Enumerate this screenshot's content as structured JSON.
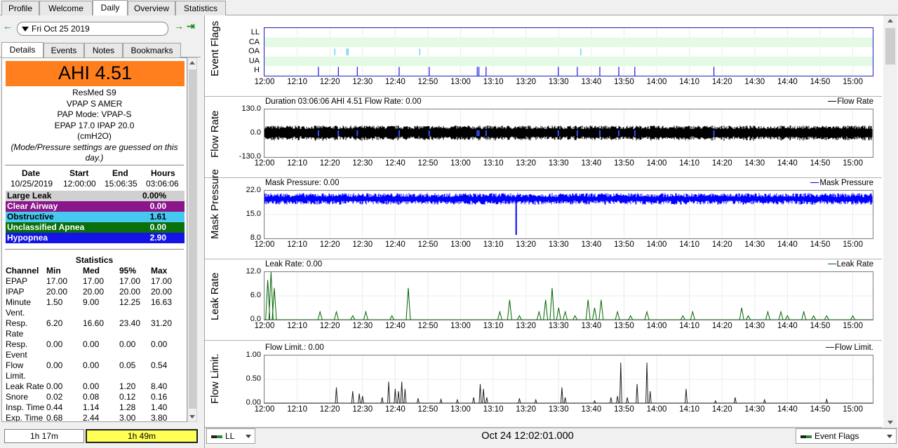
{
  "top_tabs": [
    "Profile",
    "Welcome",
    "Daily",
    "Overview",
    "Statistics"
  ],
  "active_top_tab": "Daily",
  "date_nav": {
    "date": "Fri Oct 25 2019",
    "prev_icon": "arrow-left-icon",
    "next_icon": "arrow-right-icon",
    "last_icon": "arrow-to-end-icon"
  },
  "sub_tabs": [
    "Details",
    "Events",
    "Notes",
    "Bookmarks"
  ],
  "active_sub_tab": "Details",
  "ahi": {
    "label": "AHI 4.51",
    "color": "#ff7f1e"
  },
  "machine": {
    "line1": "ResMed S9",
    "line2": "VPAP S AMER",
    "line3": "PAP Mode: VPAP-S",
    "line4": "EPAP 17.0 IPAP 20.0",
    "line5": "(cmH2O)",
    "note": "(Mode/Pressure settings are guessed on this day.)"
  },
  "session": {
    "headers": [
      "Date",
      "Start",
      "End",
      "Hours"
    ],
    "values": [
      "10/25/2019",
      "12:00:00",
      "15:06:35",
      "03:06:06"
    ]
  },
  "indices": [
    {
      "name": "Large Leak",
      "value": "0.00%",
      "bg": "#d0d0d0",
      "fg": "#000000"
    },
    {
      "name": "Clear Airway",
      "value": "0.00",
      "bg": "#8b168b",
      "fg": "#ffffff"
    },
    {
      "name": "Obstructive",
      "value": "1.61",
      "bg": "#46c8f0",
      "fg": "#000000"
    },
    {
      "name": "Unclassified Apnea",
      "value": "0.00",
      "bg": "#0a6e0a",
      "fg": "#ffffff"
    },
    {
      "name": "Hypopnea",
      "value": "2.90",
      "bg": "#1414e6",
      "fg": "#ffffff"
    }
  ],
  "statistics": {
    "title": "Statistics",
    "headers": [
      "Channel",
      "Min",
      "Med",
      "95%",
      "Max"
    ],
    "rows": [
      {
        "ch": [
          "EPAP"
        ],
        "v": [
          "17.00",
          "17.00",
          "17.00",
          "17.00"
        ]
      },
      {
        "ch": [
          "IPAP"
        ],
        "v": [
          "20.00",
          "20.00",
          "20.00",
          "20.00"
        ]
      },
      {
        "ch": [
          "Minute",
          "Vent."
        ],
        "v": [
          "1.50",
          "9.00",
          "12.25",
          "16.63"
        ]
      },
      {
        "ch": [
          "Resp.",
          "Rate"
        ],
        "v": [
          "6.20",
          "16.60",
          "23.40",
          "31.20"
        ]
      },
      {
        "ch": [
          "Resp.",
          "Event"
        ],
        "v": [
          "0.00",
          "0.00",
          "0.00",
          "0.00"
        ]
      },
      {
        "ch": [
          "Flow",
          "Limit."
        ],
        "v": [
          "0.00",
          "0.00",
          "0.05",
          "0.54"
        ]
      },
      {
        "ch": [
          "Leak Rate"
        ],
        "v": [
          "0.00",
          "0.00",
          "1.20",
          "8.40"
        ]
      },
      {
        "ch": [
          "Snore"
        ],
        "v": [
          "0.02",
          "0.08",
          "0.12",
          "0.16"
        ]
      },
      {
        "ch": [
          "Insp. Time"
        ],
        "v": [
          "0.44",
          "1.14",
          "1.28",
          "1.40"
        ]
      },
      {
        "ch": [
          "Exp. Time"
        ],
        "v": [
          "0.68",
          "2.44",
          "3.00",
          "3.80"
        ]
      }
    ]
  },
  "bottom_left": {
    "left_value": "1h 17m",
    "right_value": "1h 49m"
  },
  "x_ticks": [
    "12:00",
    "12:10",
    "12:20",
    "12:30",
    "12:40",
    "12:50",
    "13:00",
    "13:10",
    "13:20",
    "13:30",
    "13:40",
    "13:50",
    "14:00",
    "14:10",
    "14:20",
    "14:30",
    "14:40",
    "14:50",
    "15:00"
  ],
  "x_range_minutes": [
    0,
    186.1
  ],
  "graphs": {
    "event_flags": {
      "ylabel": "Event Flags",
      "rows": [
        "LL",
        "CA",
        "OA",
        "UA",
        "H"
      ],
      "oa_minutes": [
        21.5,
        25.2,
        25.6,
        47.5,
        96.8
      ],
      "h_minutes": [
        16.5,
        22.6,
        28.4,
        41.2,
        50.4,
        65.1,
        65.6,
        67.8,
        89.9,
        95.7,
        102.6,
        108.4,
        113.3,
        137.5
      ],
      "colors": {
        "oa": "#46c8f0",
        "h": "#1414e6",
        "band": "#e4fae4",
        "frame": "#2020c0"
      }
    },
    "flow_rate": {
      "ylabel": "Flow Rate",
      "title": "Duration 03:06:06 AHI 4.51 Flow Rate: 0.00",
      "legend": "Flow Rate",
      "yticks": [
        "130.0",
        "0.0",
        "-130.0"
      ],
      "ylim": [
        -130,
        130
      ],
      "amplitude": 38,
      "color": "#000000"
    },
    "mask_pressure": {
      "ylabel": "Mask Pressure",
      "title": "Mask Pressure: 0.00",
      "legend": "Mask Pressure",
      "yticks": [
        "22.0",
        "15.0",
        "8.0"
      ],
      "ylim": [
        8,
        22
      ],
      "baseline": 19.6,
      "band": 1.7,
      "dip": {
        "minute": 77,
        "value": 9
      },
      "color": "#0000ff"
    },
    "leak_rate": {
      "ylabel": "Leak Rate",
      "title": "Leak Rate: 0.00",
      "legend": "Leak Rate",
      "yticks": [
        "12.0",
        "6.0",
        "0.0"
      ],
      "ylim": [
        0,
        12
      ],
      "color": "#006400",
      "spikes": [
        [
          1,
          10
        ],
        [
          2,
          12
        ],
        [
          3,
          8
        ],
        [
          17,
          2
        ],
        [
          22,
          2
        ],
        [
          27,
          1
        ],
        [
          31,
          2
        ],
        [
          39,
          1
        ],
        [
          44,
          8
        ],
        [
          72,
          2
        ],
        [
          75,
          5
        ],
        [
          78,
          1
        ],
        [
          84,
          2
        ],
        [
          86,
          5
        ],
        [
          88,
          8
        ],
        [
          90,
          3
        ],
        [
          92,
          2
        ],
        [
          95,
          1
        ],
        [
          99,
          5
        ],
        [
          101,
          3
        ],
        [
          103,
          5
        ],
        [
          108,
          2
        ],
        [
          112,
          1
        ],
        [
          117,
          2
        ],
        [
          128,
          1
        ],
        [
          131,
          2
        ],
        [
          146,
          3
        ],
        [
          148,
          1
        ],
        [
          154,
          2
        ],
        [
          158,
          2
        ],
        [
          160,
          1
        ],
        [
          165,
          2
        ],
        [
          168,
          1
        ],
        [
          172,
          1
        ],
        [
          180,
          1
        ]
      ]
    },
    "flow_limit": {
      "ylabel": "Flow Limit.",
      "title": "Flow Limit.: 0.00",
      "legend": "Flow Limit.",
      "yticks": [
        "1.00",
        "0.50",
        "0.00"
      ],
      "ylim": [
        0,
        1
      ],
      "color": "#202020",
      "spikes": [
        [
          22,
          0.33
        ],
        [
          27,
          0.25
        ],
        [
          29,
          0.2
        ],
        [
          30,
          0.15
        ],
        [
          36,
          0.12
        ],
        [
          38,
          0.45
        ],
        [
          40,
          0.3
        ],
        [
          41,
          0.25
        ],
        [
          42,
          0.45
        ],
        [
          43,
          0.3
        ],
        [
          47,
          0.1
        ],
        [
          54,
          0.08
        ],
        [
          59,
          0.07
        ],
        [
          64,
          0.12
        ],
        [
          66,
          0.4
        ],
        [
          67,
          0.3
        ],
        [
          68,
          0.12
        ],
        [
          78,
          0.1
        ],
        [
          83,
          0.07
        ],
        [
          91,
          0.33
        ],
        [
          92,
          0.12
        ],
        [
          101,
          0.05
        ],
        [
          106,
          0.12
        ],
        [
          108,
          0.15
        ],
        [
          109,
          0.85
        ],
        [
          111,
          0.12
        ],
        [
          114,
          0.4
        ],
        [
          117,
          0.85
        ],
        [
          118,
          0.25
        ],
        [
          129,
          0.3
        ],
        [
          138,
          0.05
        ],
        [
          144,
          0.12
        ],
        [
          153,
          0.07
        ],
        [
          172,
          0.08
        ]
      ]
    }
  },
  "bottom_right": {
    "left_combo": "LL",
    "time": "Oct 24 12:02:01.000",
    "right_combo": "Event Flags"
  }
}
